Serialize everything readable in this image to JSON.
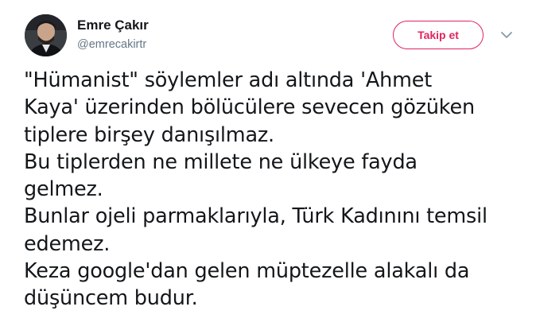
{
  "user": {
    "display_name": "Emre Çakır",
    "handle": "@emrecakirtr",
    "avatar_icon": "profile-photo"
  },
  "actions": {
    "follow_label": "Takip et",
    "more_icon": "chevron-down-icon"
  },
  "colors": {
    "follow_accent": "#e0245e",
    "secondary_text": "#657786",
    "primary_text": "#14171a"
  },
  "tweet": {
    "lines": [
      "\"Hümanist\" söylemler adı altında 'Ahmet",
      "Kaya' üzerinden bölücülere sevecen gözüken",
      "tiplere birşey danışılmaz.",
      "Bu tiplerden ne millete ne ülkeye fayda",
      "gelmez.",
      "Bunlar ojeli parmaklarıyla, Türk Kadınını temsil",
      "edemez.",
      "Keza google'dan gelen müptezelle alakalı da",
      "düşüncem budur."
    ]
  }
}
